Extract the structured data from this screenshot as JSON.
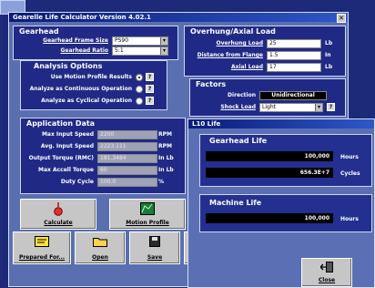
{
  "main_window": {
    "title": "Gearelle Life Calculator Version 4.02.1",
    "close_glyph": "✕"
  },
  "gearhead": {
    "title": "Gearhead",
    "frame_size_label": "Gearhead Frame Size",
    "frame_size_value": "PS90",
    "ratio_label": "Gearhead Ratio",
    "ratio_value": "5:1"
  },
  "analysis": {
    "title": "Analysis Options",
    "options": [
      {
        "label": "Use Motion Profile Results",
        "selected": true
      },
      {
        "label": "Analyze as Continuous Operation",
        "selected": false
      },
      {
        "label": "Analyze as Cyclical Operation",
        "selected": false
      }
    ],
    "help_glyph": "?"
  },
  "application": {
    "title": "Application Data",
    "rows": [
      {
        "label": "Max Input Speed",
        "value": "2200",
        "unit": "RPM"
      },
      {
        "label": "Avg. Input Speed",
        "value": "2223.111",
        "unit": "RPM"
      },
      {
        "label": "Output Torque (RMC)",
        "value": "181.3484",
        "unit": "In Lb"
      },
      {
        "label": "Max Accell Torque",
        "value": "60",
        "unit": "In Lb"
      },
      {
        "label": "Duty Cycle",
        "value": "100.0",
        "unit": "%"
      }
    ]
  },
  "overhung": {
    "title": "Overhung/Axial Load",
    "rows": [
      {
        "label": "Overhung Load",
        "value": "25",
        "unit": "Lb"
      },
      {
        "label": "Distance from Flange",
        "value": "1.5",
        "unit": "In"
      },
      {
        "label": "Axial Load",
        "value": "17",
        "unit": "Lb"
      }
    ]
  },
  "factors": {
    "title": "Factors",
    "direction_label": "Direction",
    "direction_value": "Unidirectional",
    "shock_label": "Shock Load",
    "shock_value": "Light"
  },
  "buttons": {
    "calculate": "Calculate",
    "motion_profile": "Motion Profile",
    "prepared_for": "Prepared For...",
    "open": "Open",
    "save": "Save"
  },
  "l10_window": {
    "title": "L10 Life",
    "gearhead_life_title": "Gearhead Life",
    "gearhead_hours_value": "100,000",
    "gearhead_hours_unit": "Hours",
    "gearhead_cycles_value": "656.3E+7",
    "gearhead_cycles_unit": "Cycles",
    "machine_life_title": "Machine Life",
    "machine_hours_value": "100,000",
    "machine_hours_unit": "Hours",
    "close_label": "Close"
  },
  "colors": {
    "desktop": "#1c2a79",
    "window": "#5a6fb0",
    "panel": "#202a86",
    "titlebar": "#0a1c78"
  }
}
